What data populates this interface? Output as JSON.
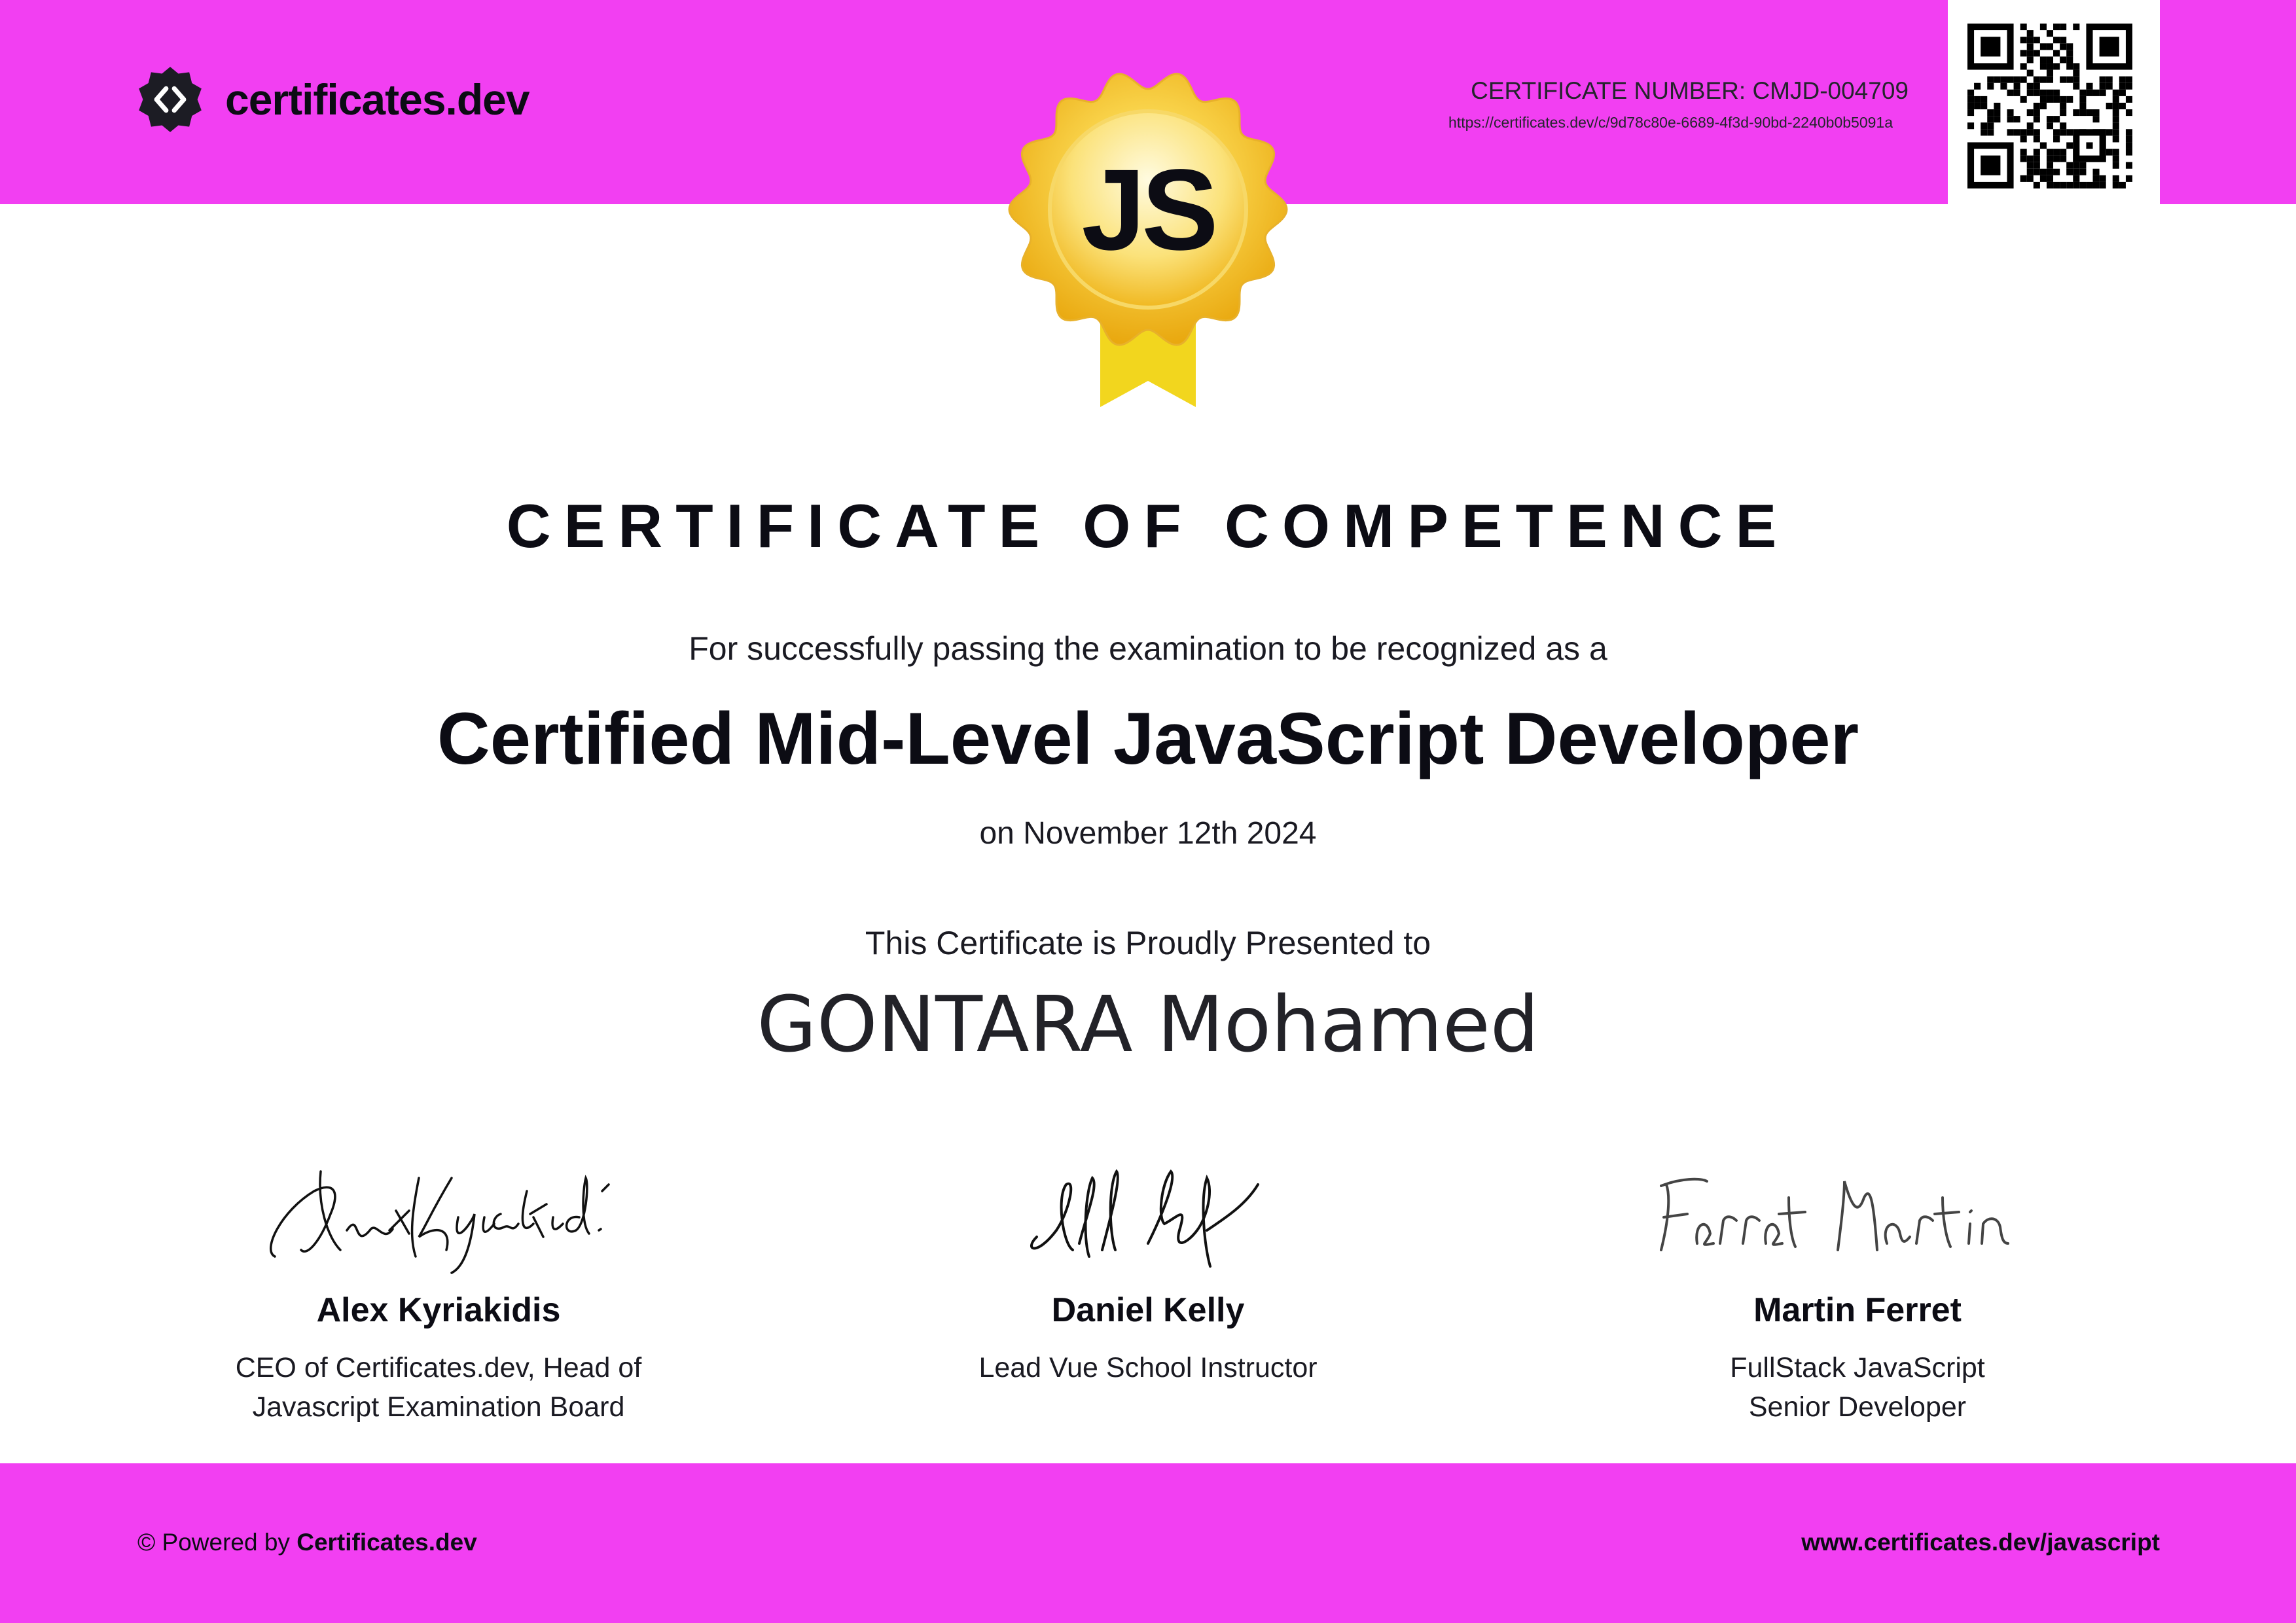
{
  "brand": {
    "name": "certificates.dev"
  },
  "certificate": {
    "number": "CERTIFICATE NUMBER: CMJD-004709",
    "url": "https://certificates.dev/c/9d78c80e-6689-4f3d-90bd-2240b0b5091a",
    "badge_text": "JS",
    "headline": "CERTIFICATE OF COMPETENCE",
    "intro": "For successfully passing the examination to be recognized as a",
    "title": "Certified Mid-Level JavaScript Developer",
    "date": "on November 12th 2024",
    "presented_to_label": "This Certificate is Proudly Presented to",
    "recipient": "GONTARA Mohamed"
  },
  "signatories": [
    {
      "signature": "AlexKyriakid.",
      "name": "Alex Kyriakidis",
      "role_lines": [
        "CEO of Certificates.dev, Head of",
        "Javascript Examination Board"
      ]
    },
    {
      "signature": "Daniel Kelly",
      "name": "Daniel Kelly",
      "role_lines": [
        "Lead Vue School Instructor"
      ]
    },
    {
      "signature": "Ferret Martin",
      "name": "Martin Ferret",
      "role_lines": [
        "FullStack JavaScript",
        "Senior Developer"
      ]
    }
  ],
  "footer": {
    "powered_prefix": "© Powered by",
    "powered_brand": "Certificates.dev",
    "link": "www.certificates.dev/javascript"
  },
  "colors": {
    "accent": "#f23ff2",
    "badge_gold": "#f5c21d",
    "ribbon": "#f2d61e",
    "text": "#0c0c14"
  },
  "icons": {
    "logo": "code-brackets-badge-icon",
    "badge": "gold-seal-icon",
    "qr": "qr-code-icon"
  }
}
